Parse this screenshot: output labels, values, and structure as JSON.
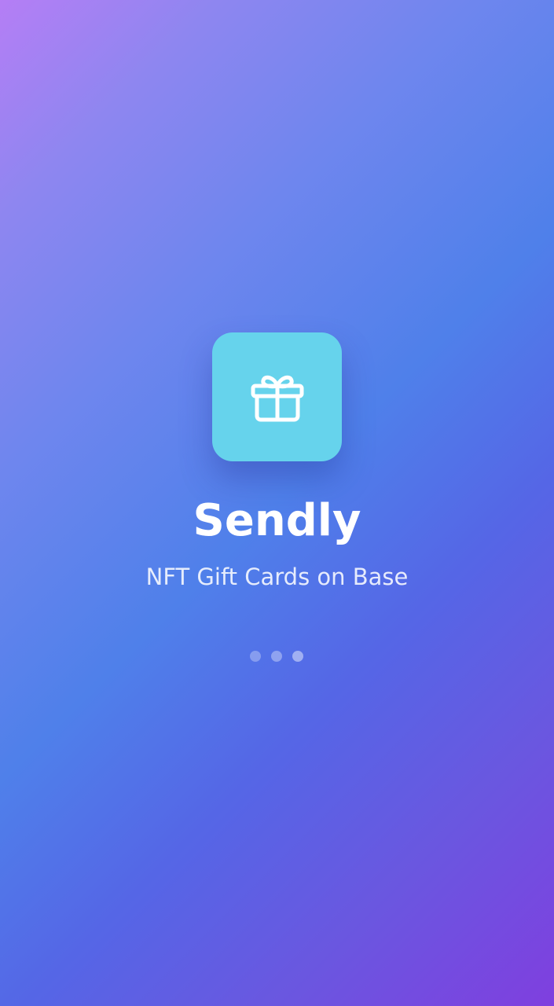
{
  "app": {
    "name": "Sendly",
    "tagline": "NFT Gift Cards on Base"
  },
  "icon": {
    "name": "gift-icon",
    "background_color": "#66d3ec",
    "glyph_color": "#ffffff"
  },
  "loading_indicator": {
    "dot_count": 3
  },
  "theme": {
    "gradient_colors": [
      "#b57ef5",
      "#4f80ea",
      "#7f3fdf"
    ]
  }
}
